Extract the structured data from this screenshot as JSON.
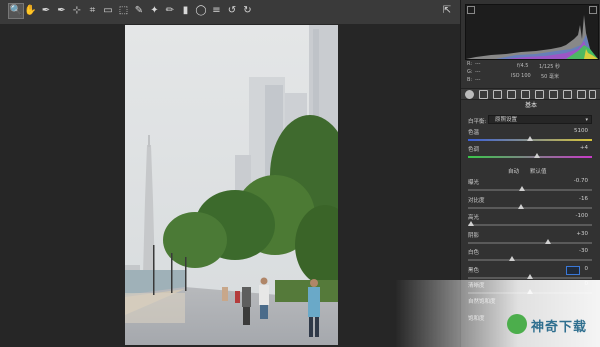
{
  "toolbar": {
    "tools": [
      {
        "name": "zoom-tool-icon",
        "glyph": "🔍"
      },
      {
        "name": "hand-tool-icon",
        "glyph": "✋"
      },
      {
        "name": "white-balance-tool-icon",
        "glyph": "✒"
      },
      {
        "name": "color-sampler-tool-icon",
        "glyph": "✒"
      },
      {
        "name": "targeted-adjustment-tool-icon",
        "glyph": "⊹"
      },
      {
        "name": "crop-tool-icon",
        "glyph": "⌗"
      },
      {
        "name": "straighten-tool-icon",
        "glyph": "▭"
      },
      {
        "name": "transform-tool-icon",
        "glyph": "⬚"
      },
      {
        "name": "spot-removal-tool-icon",
        "glyph": "✎"
      },
      {
        "name": "red-eye-tool-icon",
        "glyph": "✦"
      },
      {
        "name": "adjustment-brush-icon",
        "glyph": "✏"
      },
      {
        "name": "graduated-filter-icon",
        "glyph": "▮"
      },
      {
        "name": "radial-filter-icon",
        "glyph": "◯"
      },
      {
        "name": "presets-icon",
        "glyph": "≡"
      },
      {
        "name": "rotate-left-icon",
        "glyph": "↺"
      },
      {
        "name": "rotate-right-icon",
        "glyph": "↻"
      }
    ],
    "right_glyph": "⇱"
  },
  "meta": {
    "r": "R:",
    "g": "G:",
    "b": "B:",
    "r_val": "---",
    "g_val": "---",
    "b_val": "---",
    "aperture": "f/4.5",
    "shutter": "1/125 秒",
    "iso": "ISO 100",
    "focal": "50 毫米"
  },
  "panel": {
    "section": "基本",
    "wb_label": "白平衡:",
    "wb_value": "原照设置",
    "temp": {
      "label": "色温",
      "value": "5100",
      "pos": 0.5
    },
    "tint": {
      "label": "色调",
      "value": "+4",
      "pos": 0.56
    },
    "auto_label": "自动",
    "default_label": "默认值",
    "sliders": [
      {
        "label": "曝光",
        "value": "-0.70",
        "pos": 0.43
      },
      {
        "label": "对比度",
        "value": "-16",
        "pos": 0.42
      },
      {
        "label": "高光",
        "value": "-100",
        "pos": 0.0
      },
      {
        "label": "阴影",
        "value": "+30",
        "pos": 0.65
      },
      {
        "label": "白色",
        "value": "-30",
        "pos": 0.35
      },
      {
        "label": "黑色",
        "value": "0",
        "pos": 0.5
      }
    ],
    "clarity": {
      "label": "清晰度",
      "value": "0"
    },
    "vibrance": {
      "label": "自然饱和度"
    },
    "saturation": {
      "label": "饱和度"
    }
  },
  "watermark": {
    "text": "神奇下载"
  },
  "colors": {
    "accent": "#3a78d8",
    "panel": "#323232",
    "bg": "#262626"
  }
}
